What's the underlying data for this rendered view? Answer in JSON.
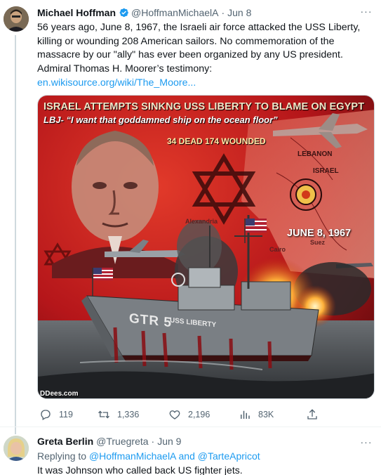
{
  "tweet": {
    "author_name": "Michael Hoffman",
    "author_handle": "@HoffmanMichaelA",
    "separator": "·",
    "date": "Jun 8",
    "more_label": "···",
    "text_line_1": "56 years ago, June 8, 1967, the Israeli air force attacked the USS Liberty,",
    "text_line_2": "killing or wounding 208 American sailors. No commemoration of the",
    "text_line_3": "massacre by our \"ally\" has ever been organized by any US president.",
    "text_line_4": "Admiral Thomas H. Moorer’s testimony:",
    "link_text": "en.wikisource.org/wiki/The_Moore...",
    "media": {
      "title": "ISRAEL ATTEMPTS SINKNG USS LIBERTY TO BLAME ON EGYPT",
      "quote": "LBJ- “I want that goddamned ship on the ocean floor”",
      "casualties": "34 DEAD 174 WOUNDED",
      "date": "JUNE 8, 1967",
      "map_lebanon": "LEBANON",
      "map_israel": "ISRAEL",
      "map_alexandria": "Alexandria",
      "map_cairo": "Cairo",
      "map_suez": "Suez",
      "hull_number": "GTR 5",
      "hull_name": "USS LIBERTY",
      "credit": "DDees.com"
    },
    "stats": {
      "replies": "119",
      "retweets": "1,336",
      "likes": "2,196",
      "views": "83K"
    },
    "icons": [
      "verified-badge-icon",
      "reply-icon",
      "retweet-icon",
      "like-icon",
      "views-icon",
      "share-icon"
    ]
  },
  "reply": {
    "author_name": "Greta Berlin",
    "author_handle": "@Truegreta",
    "separator": "·",
    "date": "Jun 9",
    "more_label": "···",
    "replying_prefix": "Replying to ",
    "replying_user_1": "@HoffmanMichaelA",
    "replying_and": " and ",
    "replying_user_2": "@TarteApricot",
    "text": "It was Johnson who called back US fighter jets."
  },
  "colors": {
    "link": "#1d9bf0",
    "verified": "#1d9bf0",
    "secondary_text": "#536471",
    "primary_text": "#0f1419",
    "media_red": "#c4161c"
  }
}
